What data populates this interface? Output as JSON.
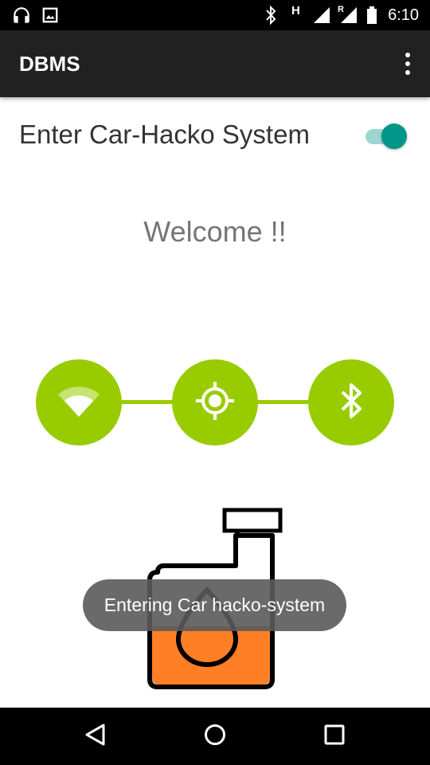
{
  "status_bar": {
    "time": "6:10",
    "icons": [
      "headphones-icon",
      "image-icon",
      "bluetooth-icon",
      "hspa-icon",
      "signal-icon",
      "roaming-signal-icon",
      "battery-icon"
    ],
    "network_type": "H",
    "roaming_mark": "R"
  },
  "app_bar": {
    "title": "DBMS",
    "overflow_icon": "more-vert-icon"
  },
  "switch_row": {
    "label": "Enter Car-Hacko System",
    "checked": true,
    "accent_color": "#009688"
  },
  "main": {
    "welcome": "Welcome !!"
  },
  "connections": {
    "color": "#99cc00",
    "items": [
      "wifi-icon",
      "location-icon",
      "bluetooth-icon"
    ]
  },
  "illustration": {
    "icon": "fuel-can-icon",
    "fill_color": "#ff7f27"
  },
  "toast": {
    "message": "Entering Car hacko-system"
  },
  "nav_bar": {
    "items": [
      "back-icon",
      "home-icon",
      "recents-icon"
    ]
  }
}
